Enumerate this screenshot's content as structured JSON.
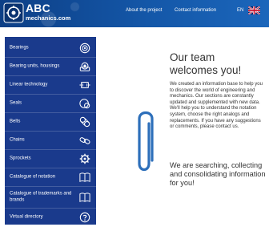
{
  "header": {
    "brand_title": "ABC",
    "brand_subtitle": "mechanics.com",
    "nav": {
      "about": "About the project",
      "contact": "Contact information"
    },
    "language": "EN",
    "colors": {
      "header_bg": "#1457a8",
      "sidebar_bg": "#1a3a8c"
    }
  },
  "sidebar": {
    "items": [
      {
        "label": "Bearings",
        "icon": "bearing-icon"
      },
      {
        "label": "Bearing units, housings",
        "icon": "bearing-unit-icon"
      },
      {
        "label": "Linear technology",
        "icon": "linear-technology-icon"
      },
      {
        "label": "Seals",
        "icon": "seal-icon"
      },
      {
        "label": "Belts",
        "icon": "belt-icon"
      },
      {
        "label": "Chains",
        "icon": "chain-icon"
      },
      {
        "label": "Sprockets",
        "icon": "sprocket-icon"
      },
      {
        "label": "Catalogue of notation",
        "icon": "book-icon"
      },
      {
        "label": "Catalogue of trademarks and brands",
        "icon": "book-icon"
      },
      {
        "label": "Virtual directory",
        "icon": "question-icon"
      }
    ]
  },
  "main": {
    "welcome": "Our team welcomes you!",
    "body": "We created an information base to help you to discover the world of engineering and mechanics. Our sections are constantly updated and supplemented with new data. We'll help you to understand the notation system, choose the right analogs and replacements. If you have any suggestions or comments, please contact us.",
    "searching": "We are searching, collecting and consolidating information for you!"
  }
}
